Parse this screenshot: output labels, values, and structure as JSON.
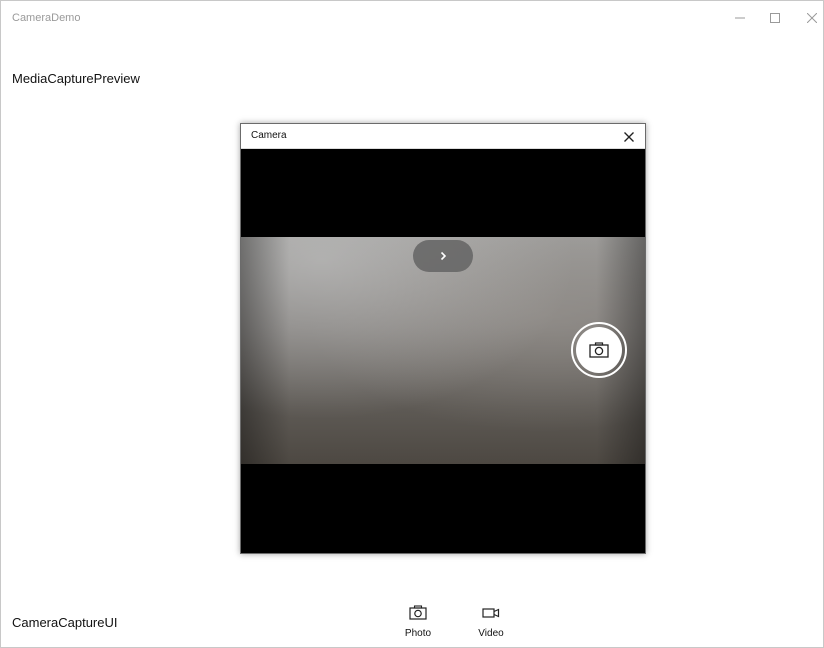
{
  "window": {
    "title": "CameraDemo",
    "controls": {
      "minimize_icon": "minimize-icon",
      "maximize_icon": "maximize-icon",
      "close_icon": "close-icon"
    }
  },
  "sections": {
    "preview_label": "MediaCapturePreview",
    "capture_label": "CameraCaptureUI"
  },
  "camera_dialog": {
    "title": "Camera",
    "close_icon": "close-icon",
    "expand_icon": "chevron-right-icon",
    "shutter_icon": "camera-icon"
  },
  "capture_buttons": [
    {
      "label": "Photo",
      "icon": "camera-icon"
    },
    {
      "label": "Video",
      "icon": "video-icon"
    }
  ],
  "colors": {
    "window_background": "#ffffff",
    "title_text": "#9a9a9a",
    "body_text": "#111111",
    "dialog_background": "#000000",
    "pill_background": "#646464"
  }
}
